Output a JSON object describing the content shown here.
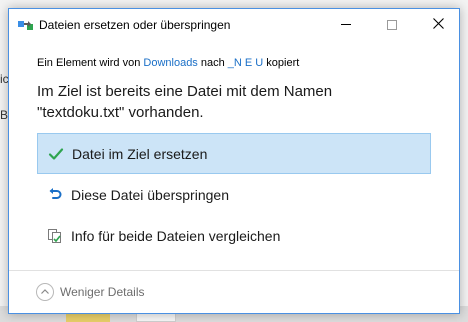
{
  "window": {
    "title": "Dateien ersetzen oder überspringen"
  },
  "background": {
    "text_fragments": [
      "ic",
      "Bil"
    ]
  },
  "message": {
    "prefix": "Ein Element wird von ",
    "source": "Downloads",
    "middle": " nach ",
    "destination": "_N E U",
    "suffix": " kopiert"
  },
  "heading": {
    "line1": "Im Ziel ist bereits eine Datei mit dem Namen",
    "line2": "\"textdoku.txt\" vorhanden."
  },
  "options": [
    {
      "label": "Datei im Ziel ersetzen",
      "icon": "checkmark-icon",
      "selected": true
    },
    {
      "label": "Diese Datei überspringen",
      "icon": "skip-arrow-icon",
      "selected": false
    },
    {
      "label": "Info für beide Dateien vergleichen",
      "icon": "compare-files-icon",
      "selected": false
    }
  ],
  "details_toggle": {
    "label": "Weniger Details",
    "icon": "chevron-up-icon"
  },
  "colors": {
    "link": "#1a6fc7",
    "selection_bg": "#cce4f7",
    "selection_border": "#99c9ef",
    "accent_green": "#2ea44f"
  }
}
